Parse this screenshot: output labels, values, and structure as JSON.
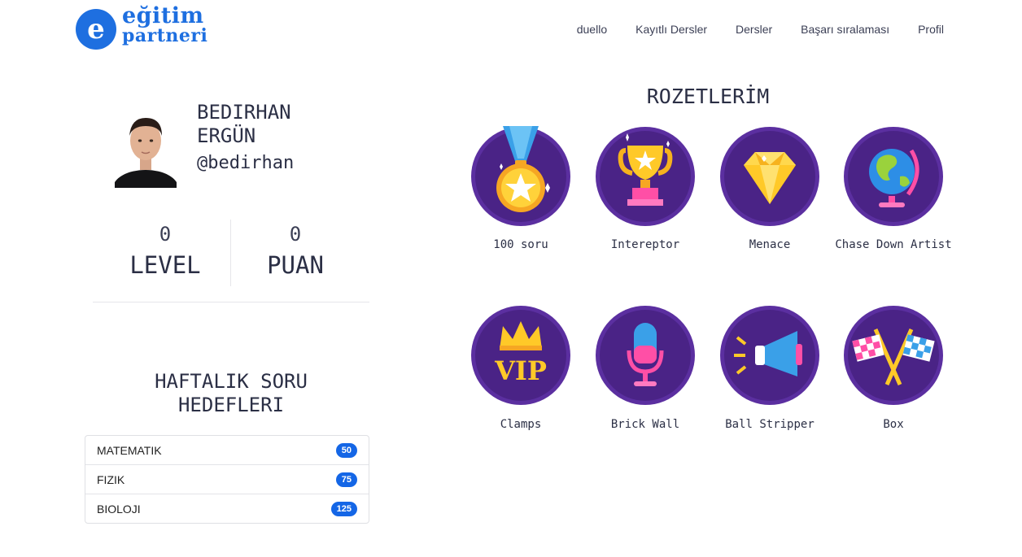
{
  "header": {
    "logo_line1": "eğitim",
    "logo_line2": "partneri",
    "nav": [
      "duello",
      "Kayıtlı Dersler",
      "Dersler",
      "Başarı sıralaması",
      "Profil"
    ]
  },
  "profile": {
    "first_name": "BEDIRHAN",
    "last_name": "ERGÜN",
    "handle": "@bedirhan",
    "level_value": "0",
    "level_label": "LEVEL",
    "points_value": "0",
    "points_label": "PUAN"
  },
  "goals": {
    "title_line1": "HAFTALIK SORU",
    "title_line2": "HEDEFLERI",
    "items": [
      {
        "subject": "MATEMATIK",
        "count": "50"
      },
      {
        "subject": "FIZIK",
        "count": "75"
      },
      {
        "subject": "BIOLOJI",
        "count": "125"
      }
    ]
  },
  "badges": {
    "title": "ROZETLERİM",
    "items": [
      {
        "label": "100 soru",
        "icon": "star-medal-icon"
      },
      {
        "label": "Intereptor",
        "icon": "trophy-icon"
      },
      {
        "label": "Menace",
        "icon": "diamond-icon"
      },
      {
        "label": "Chase Down Artist",
        "icon": "globe-icon"
      },
      {
        "label": "Clamps",
        "icon": "vip-crown-icon"
      },
      {
        "label": "Brick Wall",
        "icon": "microphone-icon"
      },
      {
        "label": "Ball Stripper",
        "icon": "megaphone-icon"
      },
      {
        "label": "Box",
        "icon": "checkered-flags-icon"
      }
    ]
  },
  "colors": {
    "accent": "#1e6fe0",
    "badge_purple": "#4a2386",
    "badge_ring": "#5b2fa0",
    "pill_blue": "#1466e6"
  }
}
